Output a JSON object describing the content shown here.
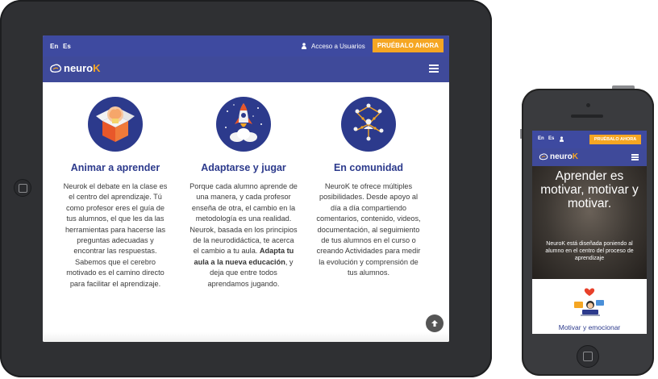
{
  "tablet": {
    "topbar": {
      "lang_en": "En",
      "lang_es": "Es",
      "access_label": "Acceso a Usuarios",
      "try_button": "PRUÉBALO AHORA"
    },
    "nav": {
      "logo_text": "neuro",
      "logo_k": "K"
    },
    "columns": [
      {
        "title": "Animar a aprender",
        "icon": "brain-box-icon",
        "text": "Neurok el debate en la clase es el centro del aprendizaje. Tú como profesor eres el guía de tus alumnos, el que les da las herramientas para hacerse las preguntas adecuadas y encontrar las respuestas. Sabemos que el cerebro motivado es el camino directo para facilitar el aprendizaje."
      },
      {
        "title": "Adaptarse y jugar",
        "icon": "rocket-icon",
        "text_before": "Porque cada alumno aprende de una manera, y cada profesor enseña de otra, el cambio en la metodología es una realidad. Neurok, basada en los principios de la neurodidáctica, te acerca el cambio a tu aula. ",
        "text_bold": "Adapta tu aula a la nueva educación",
        "text_after": ", y deja que entre todos aprendamos jugando."
      },
      {
        "title": "En comunidad",
        "icon": "community-network-icon",
        "text": "NeuroK te ofrece múltiples posibilidades. Desde apoyo al día a día compartiendo comentarios, contenido, videos, documentación, al seguimiento de tus alumnos en el curso o creando Actividades para medir la evolución y comprensión de tus alumnos."
      }
    ],
    "scroll_top_icon": "arrow-up-icon"
  },
  "phone": {
    "topbar": {
      "lang_en": "En",
      "lang_es": "Es",
      "try_button": "PRUÉBALO AHORA"
    },
    "nav": {
      "logo_text": "neuro",
      "logo_k": "K"
    },
    "hero": {
      "title": "Aprender es motivar, motivar y motivar.",
      "text": "NeuroK está diseñada poniendo al alumno en el centro del proceso de aprendizaje"
    },
    "section_title": "Motivar y emocionar"
  },
  "colors": {
    "topbar": "#3e4aa0",
    "accent": "#f5a623",
    "heading": "#2c3a8c",
    "device": "#2f3033"
  }
}
